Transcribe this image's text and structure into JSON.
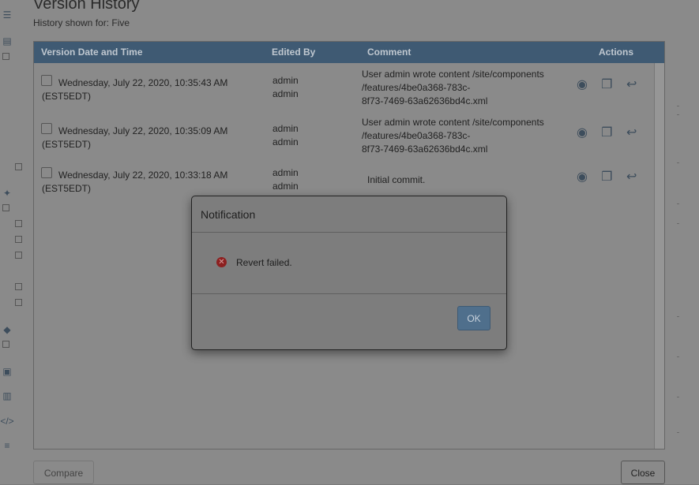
{
  "dialog": {
    "title": "Version History",
    "subtitle": "History shown for: Five",
    "columns": [
      "Version Date and Time",
      "Edited By",
      "Comment",
      "Actions"
    ],
    "rows": [
      {
        "date_line1": "Wednesday, July 22, 2020, 10:35:43 AM",
        "date_line2": "(EST5EDT)",
        "editor_line1": "admin",
        "editor_line2": "admin",
        "comment_lines": [
          "User admin wrote content /site/components",
          "/features/4be0a368-783c-",
          "8f73-7469-63a62636bd4c.xml"
        ]
      },
      {
        "date_line1": "Wednesday, July 22, 2020, 10:35:09 AM",
        "date_line2": "(EST5EDT)",
        "editor_line1": "admin",
        "editor_line2": "admin",
        "comment_lines": [
          "User admin wrote content /site/components",
          "/features/4be0a368-783c-",
          "8f73-7469-63a62636bd4c.xml"
        ]
      },
      {
        "date_line1": "Wednesday, July 22, 2020, 10:33:18 AM",
        "date_line2": "(EST5EDT)",
        "editor_line1": "admin",
        "editor_line2": "admin",
        "comment_lines": [
          "Initial commit.",
          "",
          ""
        ]
      }
    ],
    "actions": {
      "view_icon": "eye-icon",
      "compare_icon": "copy-icon",
      "revert_icon": "reply-icon"
    },
    "compare_label": "Compare",
    "close_label": "Close"
  },
  "notification": {
    "title": "Notification",
    "message": "Revert failed.",
    "ok_label": "OK",
    "icon": "error-icon",
    "accent": "#4f6f8c"
  }
}
